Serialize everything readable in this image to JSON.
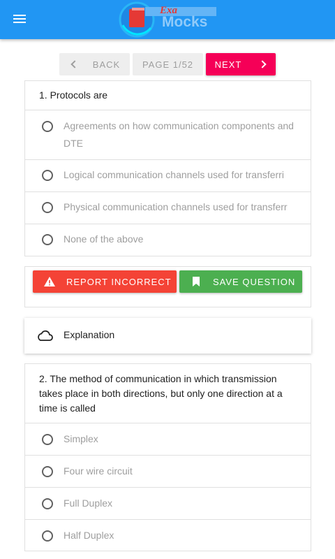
{
  "header": {
    "menu_icon": "menu-icon",
    "logo_text_top": "Exa",
    "logo_text_main": "Mocks",
    "color": "#2196f3"
  },
  "pager": {
    "back_label": "Back",
    "page_label": "Page 1/52",
    "next_label": "Next",
    "next_color": "#f50057"
  },
  "questions": [
    {
      "title": "1. Protocols are",
      "options": [
        "Agreements on how communication components and DTE",
        "Logical communication channels used for transferri",
        "Physical communication channels used for transferr",
        "None of the above"
      ]
    },
    {
      "title": "2. The method of communication in which transmission takes place in both directions, but only one direction at a time is called",
      "options": [
        "Simplex",
        "Four wire circuit",
        "Full Duplex",
        "Half Duplex"
      ]
    }
  ],
  "actions": {
    "report_label": "Report Incorrect",
    "report_color": "#f44336",
    "save_label": "Save Question",
    "save_color": "#4caf50"
  },
  "explanation": {
    "label": "Explanation",
    "icon": "cloud-icon"
  }
}
